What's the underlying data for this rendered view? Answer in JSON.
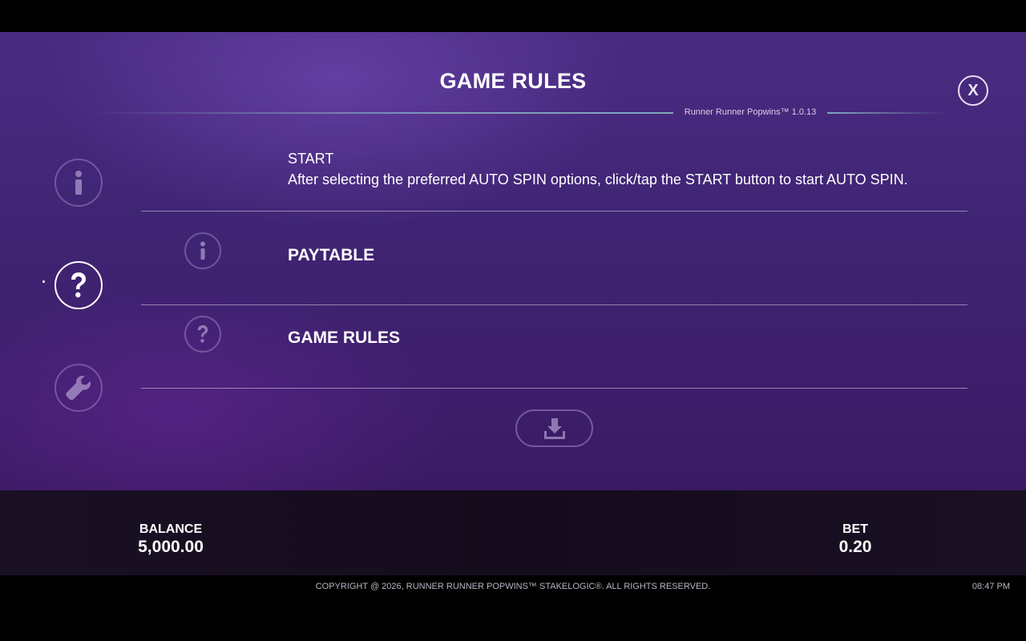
{
  "dialog": {
    "title": "GAME RULES",
    "version": "Runner Runner Popwins™ 1.0.13",
    "close_label": "X"
  },
  "sidebar": {
    "items": [
      {
        "icon": "info-icon",
        "active": false
      },
      {
        "icon": "question-icon",
        "active": true
      },
      {
        "icon": "wrench-icon",
        "active": false
      }
    ]
  },
  "content": {
    "start_heading": "START",
    "start_description": "After selecting the preferred AUTO SPIN options, click/tap the START button to start AUTO SPIN.",
    "rows": [
      {
        "icon": "info-icon",
        "label": "PAYTABLE"
      },
      {
        "icon": "question-icon",
        "label": "GAME RULES"
      }
    ]
  },
  "status_bar": {
    "balance_label": "BALANCE",
    "balance_value": "5,000.00",
    "bet_label": "BET",
    "bet_value": "0.20"
  },
  "footer": {
    "copyright": "COPYRIGHT @ 2026, RUNNER RUNNER POPWINS™ STAKELOGIC®. ALL RIGHTS RESERVED.",
    "time": "08:47 PM"
  },
  "colors": {
    "panel_top": "#4a2b82",
    "panel_bottom": "#3a1a63",
    "status_bar": "#140c1c",
    "accent_line": "#8cbec8"
  }
}
